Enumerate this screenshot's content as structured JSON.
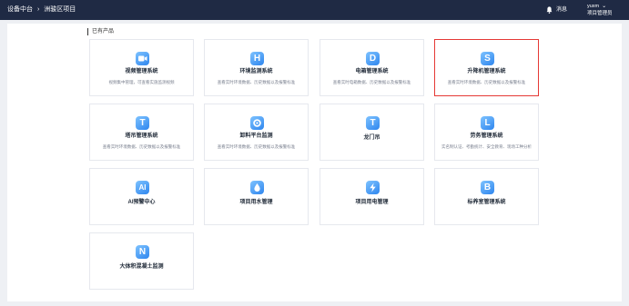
{
  "header": {
    "breadcrumb": [
      "设备中台",
      "›",
      "洲骏区项目"
    ],
    "message_label": "消息",
    "user_name": "yuxm",
    "user_role": "项目管理员"
  },
  "section_title": "已有产品",
  "products": [
    {
      "title": "视频管理系统",
      "desc": "视频集中管理，可查看实施监测视频",
      "icon": "video-icon",
      "letter": ""
    },
    {
      "title": "环境监测系统",
      "desc": "查看实时环境数据、历史数据以及报警标准",
      "icon": "letter-h-icon",
      "letter": "H"
    },
    {
      "title": "电箱管理系统",
      "desc": "查看实时电箱数据、历史数据以及报警标准",
      "icon": "letter-d-icon",
      "letter": "D"
    },
    {
      "title": "升降机管理系统",
      "desc": "查看实时环境数据、历史数据以及报警标准",
      "icon": "letter-s-icon",
      "letter": "S",
      "selected": true
    },
    {
      "title": "塔吊管理系统",
      "desc": "查看实时环境数据、历史数据以及报警标准",
      "icon": "letter-t-icon",
      "letter": "T"
    },
    {
      "title": "卸料平台监测",
      "desc": "查看实时环境数据、历史数据以及报警标准",
      "icon": "platform-icon",
      "letter": ""
    },
    {
      "title": "龙门吊",
      "desc": "",
      "icon": "letter-t-icon",
      "letter": "T"
    },
    {
      "title": "劳务管理系统",
      "desc": "实名制认证、考勤统计、安全教育、现场工种分析",
      "icon": "letter-l-icon",
      "letter": "L"
    },
    {
      "title": "AI预警中心",
      "desc": "",
      "icon": "ai-icon",
      "letter": "AI"
    },
    {
      "title": "项目用水管理",
      "desc": "",
      "icon": "water-drop-icon",
      "letter": ""
    },
    {
      "title": "项目用电管理",
      "desc": "",
      "icon": "lightning-icon",
      "letter": ""
    },
    {
      "title": "标养室管理系统",
      "desc": "",
      "icon": "letter-b-icon",
      "letter": "B"
    },
    {
      "title": "大体积混凝土监测",
      "desc": "",
      "icon": "letter-n-icon",
      "letter": "N"
    }
  ]
}
